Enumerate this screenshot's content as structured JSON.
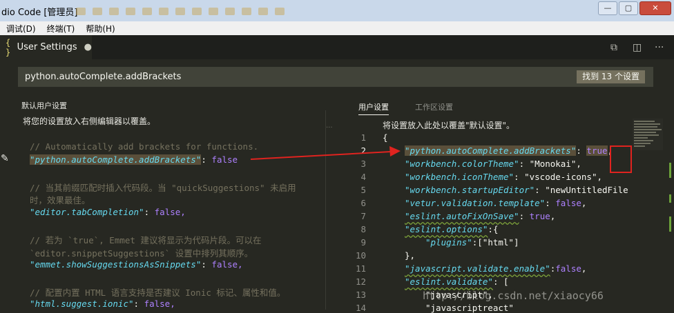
{
  "window": {
    "title": "dio Code [管理员]",
    "bookmarks": [
      "",
      "",
      "",
      "",
      "",
      "",
      "",
      "",
      "",
      "",
      "",
      "",
      ""
    ],
    "buttons": {
      "minimize": "—",
      "maximize": "▢",
      "close": "✕"
    }
  },
  "menu": {
    "items": [
      "调试(D)",
      "终端(T)",
      "帮助(H)"
    ]
  },
  "editor_tab": {
    "icon": "{ }",
    "label": "User Settings",
    "dirty_indicator": "●"
  },
  "toolbar": {
    "icons": [
      "open-json-icon",
      "split-editor-icon",
      "more-actions-icon"
    ]
  },
  "search": {
    "value": "python.autoComplete.addBrackets",
    "result_badge": "找到 13 个设置"
  },
  "default_settings": {
    "header": "默认用户设置",
    "description": "将您的设置放入右侧编辑器以覆盖。",
    "lines": [
      {
        "comment": "// Automatically add brackets for functions."
      },
      {
        "key": "\"python.autoComplete.addBrackets\"",
        "colon": ":",
        "value": "false"
      },
      {
        "comment": "// 当其前缀匹配时插入代码段。当 \"quickSuggestions\" 未启用"
      },
      {
        "comment": "时，效果最佳。"
      },
      {
        "key": "\"editor.tabCompletion\"",
        "colon": ":",
        "value": "false,"
      },
      {
        "comment": "// 若为 `true`, Emmet 建议将显示为代码片段。可以在"
      },
      {
        "comment": "`editor.snippetSuggestions` 设置中排列其顺序。"
      },
      {
        "key": "\"emmet.showSuggestionsAsSnippets\"",
        "colon": ":",
        "value": "false,"
      },
      {
        "comment": "// 配置内置 HTML 语言支持是否建议 Ionic 标记、属性和值。"
      },
      {
        "key": "\"html.suggest.ionic\"",
        "colon": ":",
        "value": "false,"
      }
    ]
  },
  "user_settings": {
    "tabs": {
      "user": "用户设置",
      "workspace": "工作区设置"
    },
    "gutter_marker": "...",
    "hint": "将设置放入此处以覆盖\"默认设置\"。",
    "line_numbers": [
      "1",
      "2",
      "3",
      "4",
      "5",
      "6",
      "7",
      "8",
      "9",
      "10",
      "11",
      "12",
      "13",
      "14"
    ],
    "lines": {
      "l1": "{",
      "l2": {
        "key": "\"python.autoComplete.addBrackets\"",
        "colon": ": ",
        "value": "true",
        "comma": ","
      },
      "l3": {
        "key": "\"workbench.colorTheme\"",
        "colon": ": ",
        "value": "\"Monokai\"",
        "comma": ","
      },
      "l4": {
        "key": "\"workbench.iconTheme\"",
        "colon": ": ",
        "value": "\"vscode-icons\"",
        "comma": ","
      },
      "l5": {
        "key": "\"workbench.startupEditor\"",
        "colon": ": ",
        "value": "\"newUntitledFile"
      },
      "l6": {
        "key": "\"vetur.validation.template\"",
        "colon": ": ",
        "value": "false",
        "comma": ","
      },
      "l7": {
        "key": "\"eslint.autoFixOnSave\"",
        "colon": ": ",
        "value": "true",
        "comma": ","
      },
      "l8": {
        "key": "\"eslint.options\"",
        "colon": ":{"
      },
      "l9": {
        "key": "\"plugins\"",
        "colon": ":[",
        "value": "\"html\"",
        "close": "]"
      },
      "l10": "},",
      "l11": {
        "key": "\"javascript.validate.enable\"",
        "colon": ":",
        "value": "false",
        "comma": ","
      },
      "l12": {
        "key": "\"eslint.validate\"",
        "colon": ": ["
      },
      "l13": {
        "value": "\"javascript\"",
        "comma": ","
      },
      "l14": {
        "value": "\"javascriptreact\""
      }
    }
  },
  "watermark": "http://blog.csdn.net/xiaocy66",
  "colors": {
    "annotation": "#e0231f",
    "comment": "#75715e",
    "key": "#66d9ef",
    "boolean": "#ae81ff",
    "string": "#e6db74",
    "background": "#272822"
  }
}
